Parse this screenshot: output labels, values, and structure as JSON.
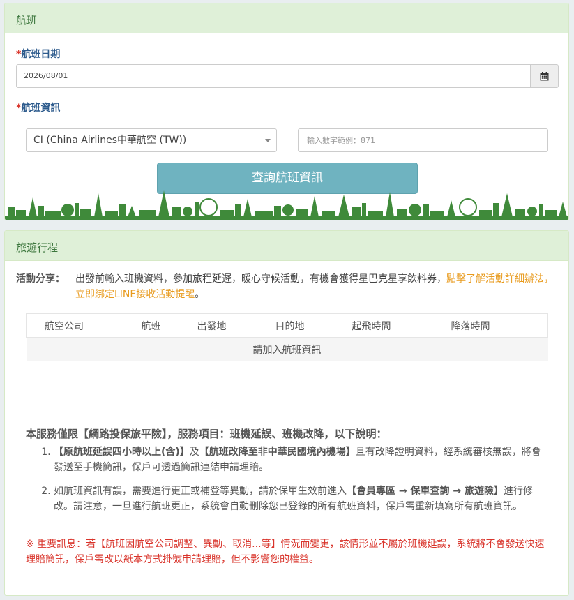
{
  "flight_panel": {
    "heading": "航班",
    "date_label": "航班日期",
    "date_value": "2026/08/01",
    "info_label": "航班資訊",
    "airline_selected": "CI (China Airlines中華航空 (TW))",
    "flight_no_placeholder": "輸入數字範例：871",
    "query_button": "查詢航班資訊"
  },
  "required_mark": "*",
  "trip_panel": {
    "heading": "旅遊行程",
    "share_label": "活動分享：",
    "share_text": "出發前輸入班機資料，參加旅程延遲，暖心守候活動，有機會獲得星巴克星享飲料券，",
    "share_link1": "點擊了解活動詳細辦法，",
    "share_link2": "立即綁定LINE接收活動提醒",
    "share_end": "。",
    "table": {
      "columns": [
        "航空公司",
        "航班",
        "出發地",
        "目的地",
        "起飛時間",
        "降落時間"
      ],
      "empty_text": "請加入航班資訊"
    },
    "notice": {
      "title": "本服務僅限【網路投保旅平險】，服務項目：班機延誤、班機改降，以下說明：",
      "item1_a": "【原航班延誤四小時以上(含)】",
      "item1_b": "及",
      "item1_c": "【航班改降至非中華民國境內機場】",
      "item1_d": "且有改降證明資料，經系統審核無誤，將會發送至手機簡訊，保戶可透過簡訊連結申請理賠。",
      "item2_a": "如航班資訊有誤，需要進行更正或補登等異動，請於保單生效前進入",
      "item2_b": "【會員專區 → 保單查詢 → 旅遊險】",
      "item2_c": "進行修改。請注意，一旦進行航班更正，系統會自動刪除您已登錄的所有航班資料，保戶需重新填寫所有航班資訊。"
    },
    "warning": "※ 重要訊息：若【航班因航空公司調整、異動、取消...等】情況而變更，該情形並不屬於班機延誤，系統將不會發送快速理賠簡訊，保戶需改以紙本方式掛號申請理賠，但不影響您的權益。"
  },
  "colors": {
    "heading_bg": "#dff0d8",
    "heading_text": "#3c763d",
    "label_blue": "#2c5a8c",
    "required_red": "#d9342b",
    "button": "#6fb3c0",
    "link_orange": "#e89a1c",
    "skyline_green": "#3f8a3a"
  },
  "icons": {
    "date_addon": "calendar-icon",
    "select_caret": "caret-down-icon",
    "footer_decoration": "city-skyline-icon"
  }
}
